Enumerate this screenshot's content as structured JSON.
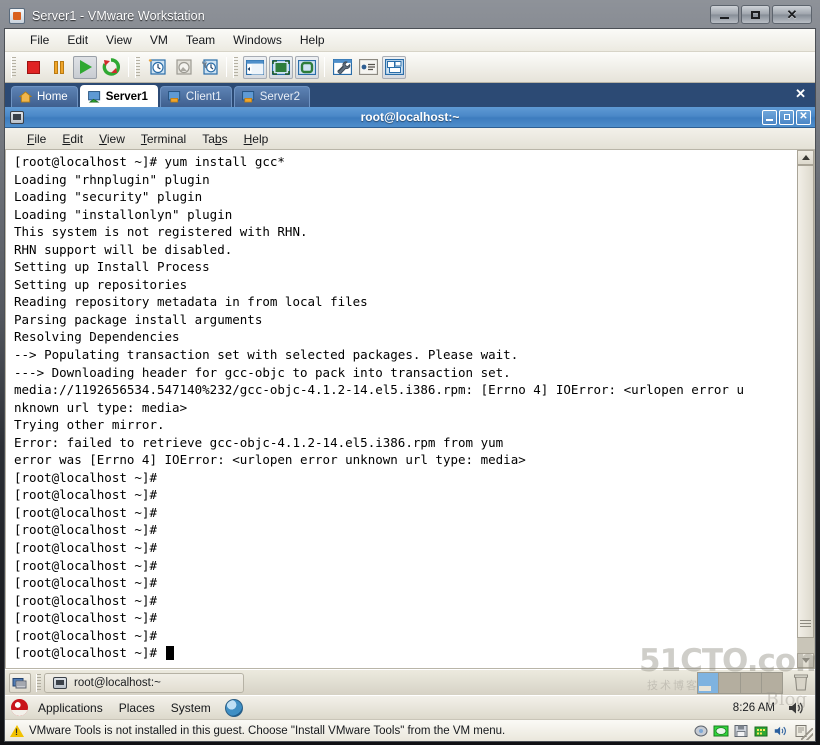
{
  "window": {
    "title": "Server1 - VMware Workstation",
    "app_icon": "vmware-icon",
    "controls": {
      "minimize": "minimize",
      "maximize": "maximize",
      "close": "close"
    }
  },
  "menubar": {
    "items": [
      "File",
      "Edit",
      "View",
      "VM",
      "Team",
      "Windows",
      "Help"
    ]
  },
  "toolbar": {
    "groups": [
      [
        {
          "name": "power-off-button",
          "icon": "stop-square-icon"
        },
        {
          "name": "suspend-button",
          "icon": "pause-icon"
        },
        {
          "name": "power-on-button",
          "icon": "play-triangle-icon"
        },
        {
          "name": "reset-button",
          "icon": "reset-arrows-icon"
        }
      ],
      [
        {
          "name": "snapshot-button",
          "icon": "snapshot-clock-icon"
        },
        {
          "name": "revert-snapshot-button",
          "icon": "revert-clock-icon"
        },
        {
          "name": "snapshot-manager-button",
          "icon": "snapshot-manager-icon"
        }
      ],
      [
        {
          "name": "show-sidebar-button",
          "icon": "sidebar-panel-icon"
        },
        {
          "name": "fullscreen-button",
          "icon": "fullscreen-icon"
        },
        {
          "name": "quick-switch-button",
          "icon": "quick-switch-icon"
        }
      ],
      [
        {
          "name": "vm-settings-button",
          "icon": "wrench-window-icon"
        },
        {
          "name": "vm-summary-button",
          "icon": "summary-list-icon"
        },
        {
          "name": "console-view-button",
          "icon": "console-windows-icon"
        }
      ]
    ]
  },
  "tabs": {
    "items": [
      {
        "label": "Home",
        "icon": "home-icon",
        "state": "home"
      },
      {
        "label": "Server1",
        "icon": "vm-icon",
        "state": "active"
      },
      {
        "label": "Client1",
        "icon": "vm-icon",
        "state": "inactive"
      },
      {
        "label": "Server2",
        "icon": "vm-icon",
        "state": "inactive"
      }
    ],
    "close_label": "✕"
  },
  "terminal": {
    "title": "root@localhost:~",
    "icon": "terminal-icon",
    "controls": {
      "minimize": "_",
      "maximize": "▫",
      "close": "✕"
    },
    "menu": [
      {
        "label": "File",
        "mnemonic": "F"
      },
      {
        "label": "Edit",
        "mnemonic": "E"
      },
      {
        "label": "View",
        "mnemonic": "V"
      },
      {
        "label": "Terminal",
        "mnemonic": "T"
      },
      {
        "label": "Tabs",
        "mnemonic": "b"
      },
      {
        "label": "Help",
        "mnemonic": "H"
      }
    ],
    "lines": [
      "[root@localhost ~]# yum install gcc*",
      "Loading \"rhnplugin\" plugin",
      "Loading \"security\" plugin",
      "Loading \"installonlyn\" plugin",
      "This system is not registered with RHN.",
      "RHN support will be disabled.",
      "Setting up Install Process",
      "Setting up repositories",
      "Reading repository metadata in from local files",
      "Parsing package install arguments",
      "Resolving Dependencies",
      "--> Populating transaction set with selected packages. Please wait.",
      "---> Downloading header for gcc-objc to pack into transaction set.",
      "media://1192656534.547140%232/gcc-objc-4.1.2-14.el5.i386.rpm: [Errno 4] IOError: <urlopen error u",
      "nknown url type: media>",
      "Trying other mirror.",
      "Error: failed to retrieve gcc-objc-4.1.2-14.el5.i386.rpm from yum",
      "error was [Errno 4] IOError: <urlopen error unknown url type: media>",
      "[root@localhost ~]#",
      "[root@localhost ~]#",
      "[root@localhost ~]#",
      "[root@localhost ~]#",
      "[root@localhost ~]#",
      "[root@localhost ~]#",
      "[root@localhost ~]#",
      "[root@localhost ~]#",
      "[root@localhost ~]#",
      "[root@localhost ~]#"
    ],
    "prompt_with_cursor": "[root@localhost ~]# ",
    "scrollbar": {
      "up_arrow": "scroll-up-arrow-icon",
      "down_arrow": "scroll-down-arrow-icon"
    }
  },
  "gnome_window_list": {
    "show_desktop_icon": "show-desktop-icon",
    "task_label": "root@localhost:~",
    "task_icon": "terminal-icon",
    "workspaces": 4,
    "active_workspace": 1,
    "trash_icon": "trash-icon"
  },
  "gnome_panel": {
    "menu_icon": "red-hat-icon",
    "items": [
      "Applications",
      "Places",
      "System"
    ],
    "browser_icon": "web-browser-icon",
    "clock": "8:26 AM",
    "volume_icon": "volume-icon"
  },
  "vmware_status": {
    "warning_icon": "warning-triangle-icon",
    "message": "VMware Tools is not installed in this guest. Choose \"Install VMware Tools\" from the VM menu.",
    "tray": [
      {
        "name": "hard-disk-tray-icon"
      },
      {
        "name": "cdrom-tray-icon"
      },
      {
        "name": "floppy-tray-icon"
      },
      {
        "name": "network-tray-icon"
      },
      {
        "name": "sound-tray-icon"
      },
      {
        "name": "usb-tray-icon"
      }
    ]
  },
  "watermark": {
    "text": "51CTO.com",
    "subtitle": "技术博客",
    "blog": "Blog"
  },
  "colors": {
    "tabbar_blue": "#2c4a74",
    "terminal_title_blue": "#4a88c8",
    "terminal_bg": "#ffffff",
    "panel_bg": "#ddd9cc",
    "warning_yellow": "#f2c200"
  }
}
